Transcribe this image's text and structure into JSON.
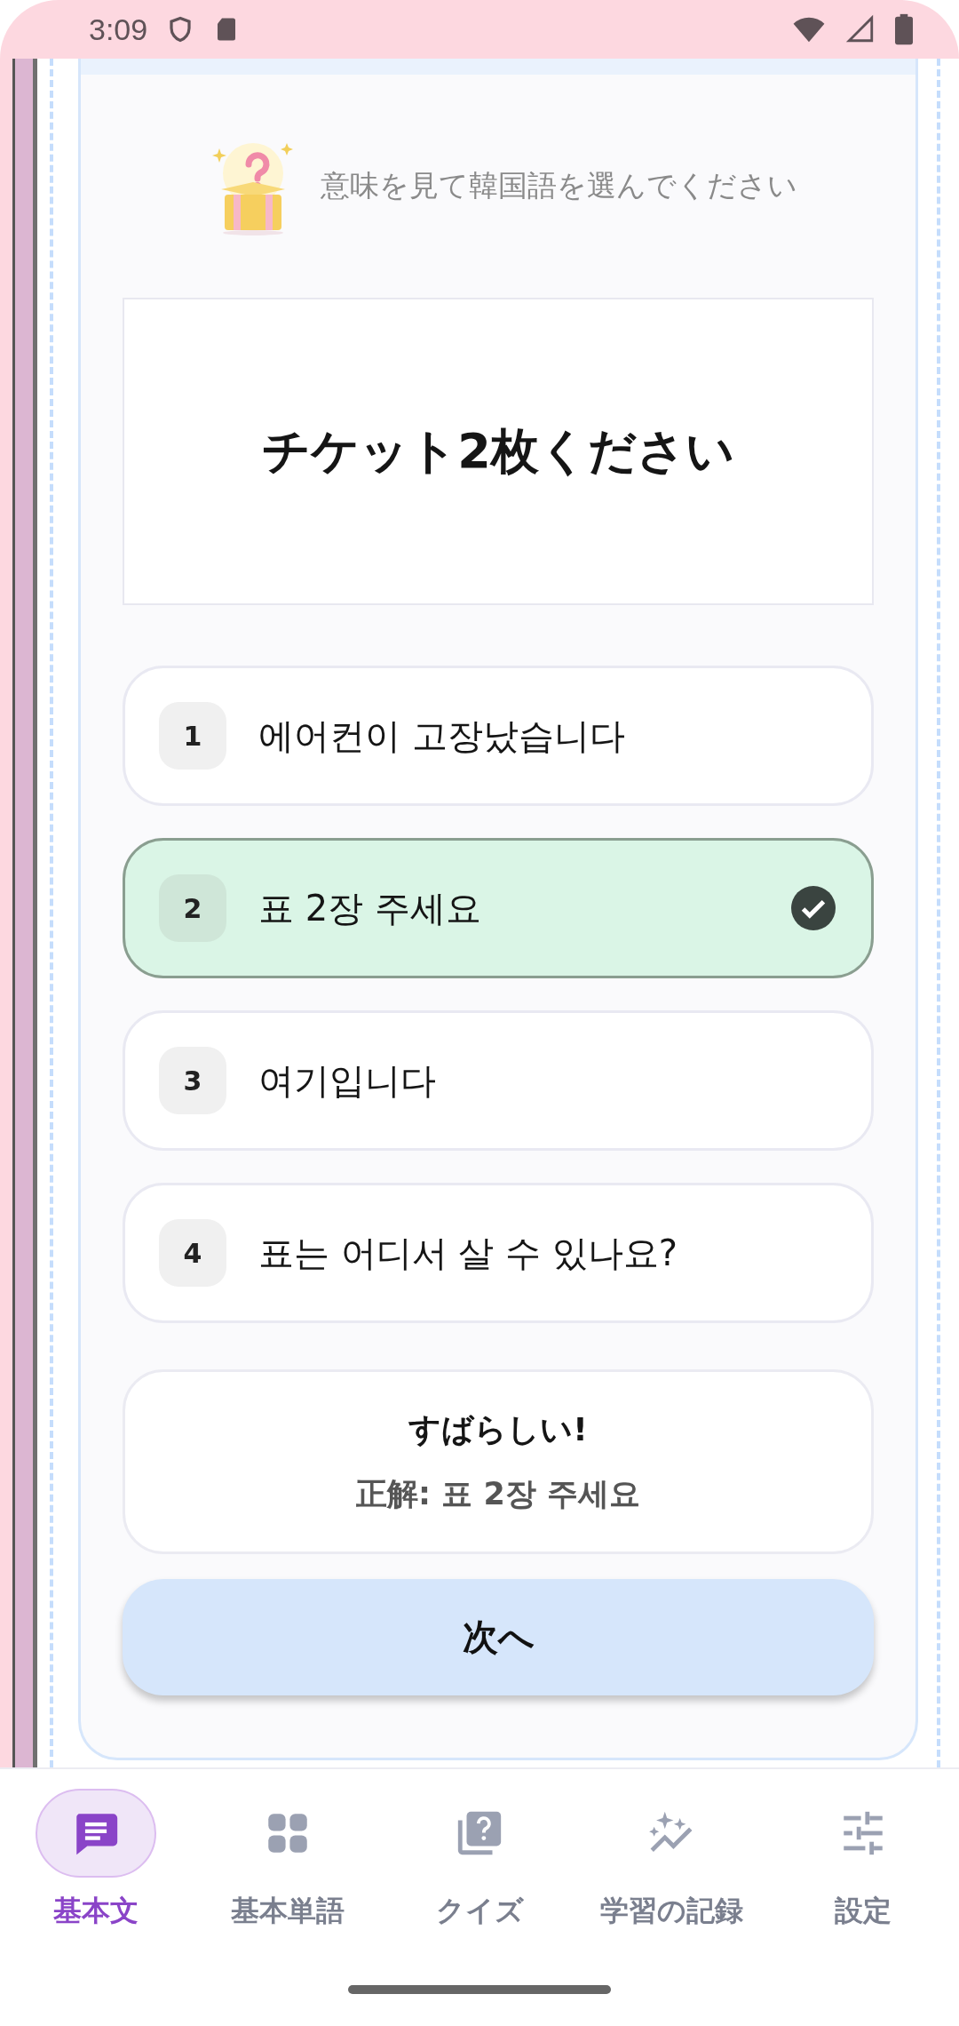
{
  "status_bar": {
    "time": "3:09"
  },
  "prompt": "意味を見て韓国語を選んでください",
  "question": "チケット2枚ください",
  "options": [
    {
      "number": "1",
      "text": "에어컨이 고장났습니다",
      "selected": false
    },
    {
      "number": "2",
      "text": "표 2장 주세요",
      "selected": true
    },
    {
      "number": "3",
      "text": "여기입니다",
      "selected": false
    },
    {
      "number": "4",
      "text": "표는 어디서 살 수 있나요?",
      "selected": false
    }
  ],
  "feedback": {
    "title": "すばらしい!",
    "answer": "正解: 표 2장 주세요"
  },
  "next_button": "次へ",
  "nav": [
    {
      "kind": "chat",
      "label": "基本文",
      "selected": true
    },
    {
      "kind": "grid",
      "label": "基本単語",
      "selected": false
    },
    {
      "kind": "quiz",
      "label": "クイズ",
      "selected": false
    },
    {
      "kind": "progress",
      "label": "学習の記録",
      "selected": false
    },
    {
      "kind": "settings",
      "label": "設定",
      "selected": false
    }
  ]
}
